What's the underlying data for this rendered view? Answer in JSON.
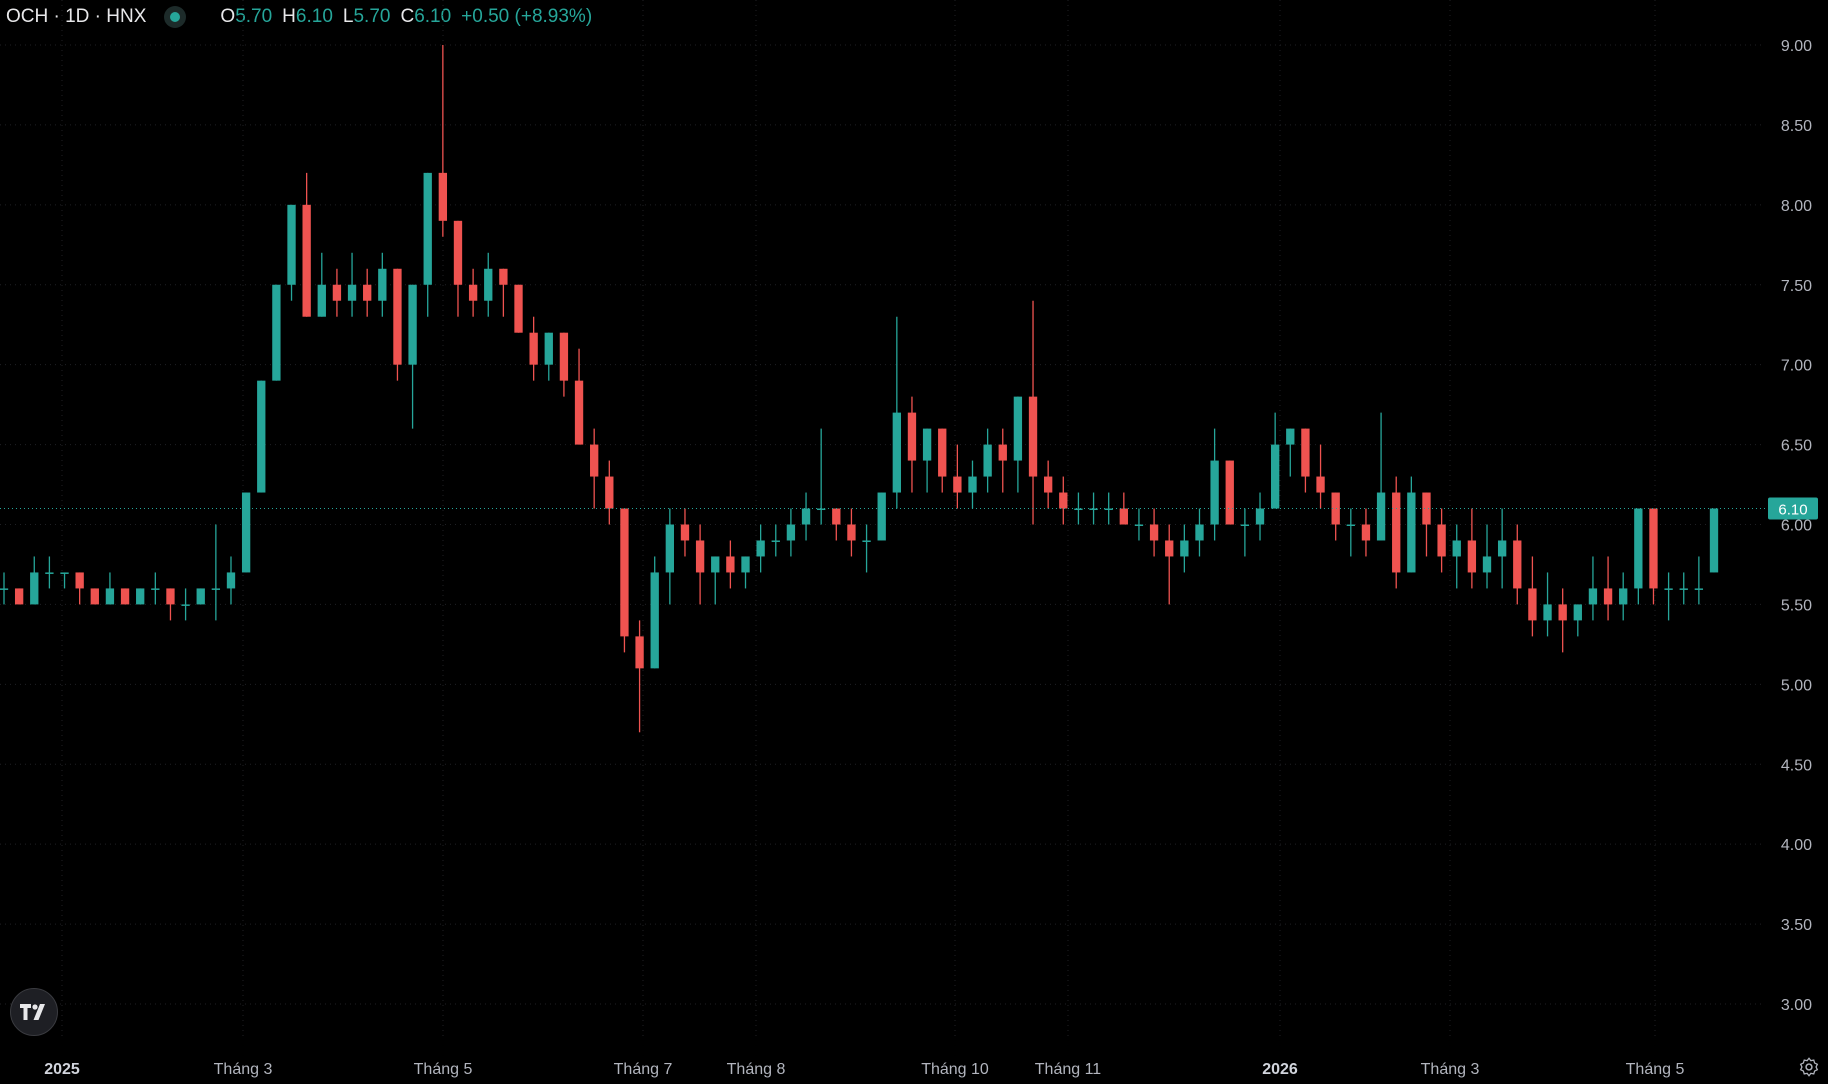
{
  "legend": {
    "symbol": "OCH · 1D · HNX",
    "o_label": "O",
    "o_value": "5.70",
    "h_label": "H",
    "h_value": "6.10",
    "l_label": "L",
    "l_value": "5.70",
    "c_label": "C",
    "c_value": "6.10",
    "change": "+0.50 (+8.93%)"
  },
  "icons": {
    "logo": "tradingview-logo-icon",
    "settings": "gear-icon",
    "status": "live-dot-icon"
  },
  "colors": {
    "up": "#26a69a",
    "down": "#ef5350",
    "background": "#000000",
    "grid": "#1f2024",
    "axis_text": "#b2b5be"
  },
  "chart_data": {
    "type": "candlestick",
    "title": "OCH · 1D · HNX",
    "ylim": [
      2.75,
      9.15
    ],
    "y_ticks": [
      "9.00",
      "8.50",
      "8.00",
      "7.50",
      "7.00",
      "6.50",
      "6.00",
      "5.50",
      "5.00",
      "4.50",
      "4.00",
      "3.50",
      "3.00"
    ],
    "x_ticks": [
      {
        "label": "2025",
        "bold": true,
        "index": 0
      },
      {
        "label": "Tháng 3",
        "bold": false,
        "index": 1
      },
      {
        "label": "Tháng 5",
        "bold": false,
        "index": 2
      },
      {
        "label": "Tháng 7",
        "bold": false,
        "index": 3
      },
      {
        "label": "Tháng 8",
        "bold": false,
        "index": 4
      },
      {
        "label": "Tháng 10",
        "bold": false,
        "index": 5
      },
      {
        "label": "Tháng 11",
        "bold": false,
        "index": 6
      },
      {
        "label": "2026",
        "bold": true,
        "index": 7
      },
      {
        "label": "Tháng 3",
        "bold": false,
        "index": 8
      },
      {
        "label": "Tháng 5",
        "bold": false,
        "index": 9
      }
    ],
    "last_price": "6.10",
    "candles_approx": [
      [
        5.6,
        5.7,
        5.5,
        5.6
      ],
      [
        5.6,
        5.6,
        5.5,
        5.5
      ],
      [
        5.5,
        5.8,
        5.5,
        5.7
      ],
      [
        5.7,
        5.8,
        5.6,
        5.7
      ],
      [
        5.7,
        5.7,
        5.6,
        5.7
      ],
      [
        5.7,
        5.7,
        5.5,
        5.6
      ],
      [
        5.6,
        5.6,
        5.5,
        5.5
      ],
      [
        5.5,
        5.7,
        5.5,
        5.6
      ],
      [
        5.6,
        5.6,
        5.5,
        5.5
      ],
      [
        5.5,
        5.6,
        5.5,
        5.6
      ],
      [
        5.6,
        5.7,
        5.5,
        5.6
      ],
      [
        5.6,
        5.6,
        5.4,
        5.5
      ],
      [
        5.5,
        5.6,
        5.4,
        5.5
      ],
      [
        5.5,
        5.6,
        5.5,
        5.6
      ],
      [
        5.6,
        6.0,
        5.4,
        5.6
      ],
      [
        5.6,
        5.8,
        5.5,
        5.7
      ],
      [
        5.7,
        6.2,
        5.7,
        6.2
      ],
      [
        6.2,
        6.9,
        6.2,
        6.9
      ],
      [
        6.9,
        7.5,
        6.9,
        7.5
      ],
      [
        7.5,
        8.0,
        7.4,
        8.0
      ],
      [
        8.0,
        8.2,
        7.3,
        7.3
      ],
      [
        7.3,
        7.7,
        7.3,
        7.5
      ],
      [
        7.5,
        7.6,
        7.3,
        7.4
      ],
      [
        7.4,
        7.7,
        7.3,
        7.5
      ],
      [
        7.5,
        7.6,
        7.3,
        7.4
      ],
      [
        7.4,
        7.7,
        7.3,
        7.6
      ],
      [
        7.6,
        7.6,
        6.9,
        7.0
      ],
      [
        7.0,
        7.5,
        6.6,
        7.5
      ],
      [
        7.5,
        8.2,
        7.3,
        8.2
      ],
      [
        8.2,
        9.0,
        7.8,
        7.9
      ],
      [
        7.9,
        7.9,
        7.3,
        7.5
      ],
      [
        7.5,
        7.6,
        7.3,
        7.4
      ],
      [
        7.4,
        7.7,
        7.3,
        7.6
      ],
      [
        7.6,
        7.6,
        7.3,
        7.5
      ],
      [
        7.5,
        7.5,
        7.2,
        7.2
      ],
      [
        7.2,
        7.3,
        6.9,
        7.0
      ],
      [
        7.0,
        7.2,
        6.9,
        7.2
      ],
      [
        7.2,
        7.2,
        6.8,
        6.9
      ],
      [
        6.9,
        7.1,
        6.5,
        6.5
      ],
      [
        6.5,
        6.6,
        6.1,
        6.3
      ],
      [
        6.3,
        6.4,
        6.0,
        6.1
      ],
      [
        6.1,
        6.1,
        5.2,
        5.3
      ],
      [
        5.3,
        5.4,
        4.7,
        5.1
      ],
      [
        5.1,
        5.8,
        5.1,
        5.7
      ],
      [
        5.7,
        6.1,
        5.5,
        6.0
      ],
      [
        6.0,
        6.1,
        5.8,
        5.9
      ],
      [
        5.9,
        6.0,
        5.5,
        5.7
      ],
      [
        5.7,
        5.8,
        5.5,
        5.8
      ],
      [
        5.8,
        5.9,
        5.6,
        5.7
      ],
      [
        5.7,
        5.8,
        5.6,
        5.8
      ],
      [
        5.8,
        6.0,
        5.7,
        5.9
      ],
      [
        5.9,
        6.0,
        5.8,
        5.9
      ],
      [
        5.9,
        6.1,
        5.8,
        6.0
      ],
      [
        6.0,
        6.2,
        5.9,
        6.1
      ],
      [
        6.1,
        6.6,
        6.0,
        6.1
      ],
      [
        6.1,
        6.1,
        5.9,
        6.0
      ],
      [
        6.0,
        6.1,
        5.8,
        5.9
      ],
      [
        5.9,
        6.0,
        5.7,
        5.9
      ],
      [
        5.9,
        6.2,
        5.9,
        6.2
      ],
      [
        6.2,
        7.3,
        6.1,
        6.7
      ],
      [
        6.7,
        6.8,
        6.2,
        6.4
      ],
      [
        6.4,
        6.6,
        6.2,
        6.6
      ],
      [
        6.6,
        6.6,
        6.2,
        6.3
      ],
      [
        6.3,
        6.5,
        6.1,
        6.2
      ],
      [
        6.2,
        6.4,
        6.1,
        6.3
      ],
      [
        6.3,
        6.6,
        6.2,
        6.5
      ],
      [
        6.5,
        6.6,
        6.2,
        6.4
      ],
      [
        6.4,
        6.8,
        6.2,
        6.8
      ],
      [
        6.8,
        7.4,
        6.0,
        6.3
      ],
      [
        6.3,
        6.4,
        6.1,
        6.2
      ],
      [
        6.2,
        6.3,
        6.0,
        6.1
      ],
      [
        6.1,
        6.2,
        6.0,
        6.1
      ],
      [
        6.1,
        6.2,
        6.0,
        6.1
      ],
      [
        6.1,
        6.2,
        6.0,
        6.1
      ],
      [
        6.1,
        6.2,
        6.0,
        6.0
      ],
      [
        6.0,
        6.1,
        5.9,
        6.0
      ],
      [
        6.0,
        6.1,
        5.8,
        5.9
      ],
      [
        5.9,
        6.0,
        5.5,
        5.8
      ],
      [
        5.8,
        6.0,
        5.7,
        5.9
      ],
      [
        5.9,
        6.1,
        5.8,
        6.0
      ],
      [
        6.0,
        6.6,
        5.9,
        6.4
      ],
      [
        6.4,
        6.4,
        6.0,
        6.0
      ],
      [
        6.0,
        6.1,
        5.8,
        6.0
      ],
      [
        6.0,
        6.2,
        5.9,
        6.1
      ],
      [
        6.1,
        6.7,
        6.1,
        6.5
      ],
      [
        6.5,
        6.6,
        6.3,
        6.6
      ],
      [
        6.6,
        6.6,
        6.2,
        6.3
      ],
      [
        6.3,
        6.5,
        6.1,
        6.2
      ],
      [
        6.2,
        6.2,
        5.9,
        6.0
      ],
      [
        6.0,
        6.1,
        5.8,
        6.0
      ],
      [
        6.0,
        6.1,
        5.8,
        5.9
      ],
      [
        5.9,
        6.7,
        5.9,
        6.2
      ],
      [
        6.2,
        6.3,
        5.6,
        5.7
      ],
      [
        5.7,
        6.3,
        5.7,
        6.2
      ],
      [
        6.2,
        6.2,
        5.8,
        6.0
      ],
      [
        6.0,
        6.1,
        5.7,
        5.8
      ],
      [
        5.8,
        6.0,
        5.6,
        5.9
      ],
      [
        5.9,
        6.1,
        5.6,
        5.7
      ],
      [
        5.7,
        6.0,
        5.6,
        5.8
      ],
      [
        5.8,
        6.1,
        5.6,
        5.9
      ],
      [
        5.9,
        6.0,
        5.5,
        5.6
      ],
      [
        5.6,
        5.8,
        5.3,
        5.4
      ],
      [
        5.4,
        5.7,
        5.3,
        5.5
      ],
      [
        5.5,
        5.6,
        5.2,
        5.4
      ],
      [
        5.4,
        5.5,
        5.3,
        5.5
      ],
      [
        5.5,
        5.8,
        5.4,
        5.6
      ],
      [
        5.6,
        5.8,
        5.4,
        5.5
      ],
      [
        5.5,
        5.7,
        5.4,
        5.6
      ],
      [
        5.6,
        6.1,
        5.5,
        6.1
      ],
      [
        6.1,
        6.1,
        5.5,
        5.6
      ],
      [
        5.6,
        5.7,
        5.4,
        5.6
      ],
      [
        5.6,
        5.7,
        5.5,
        5.6
      ],
      [
        5.6,
        5.8,
        5.5,
        5.6
      ],
      [
        5.7,
        6.1,
        5.7,
        6.1
      ]
    ]
  }
}
